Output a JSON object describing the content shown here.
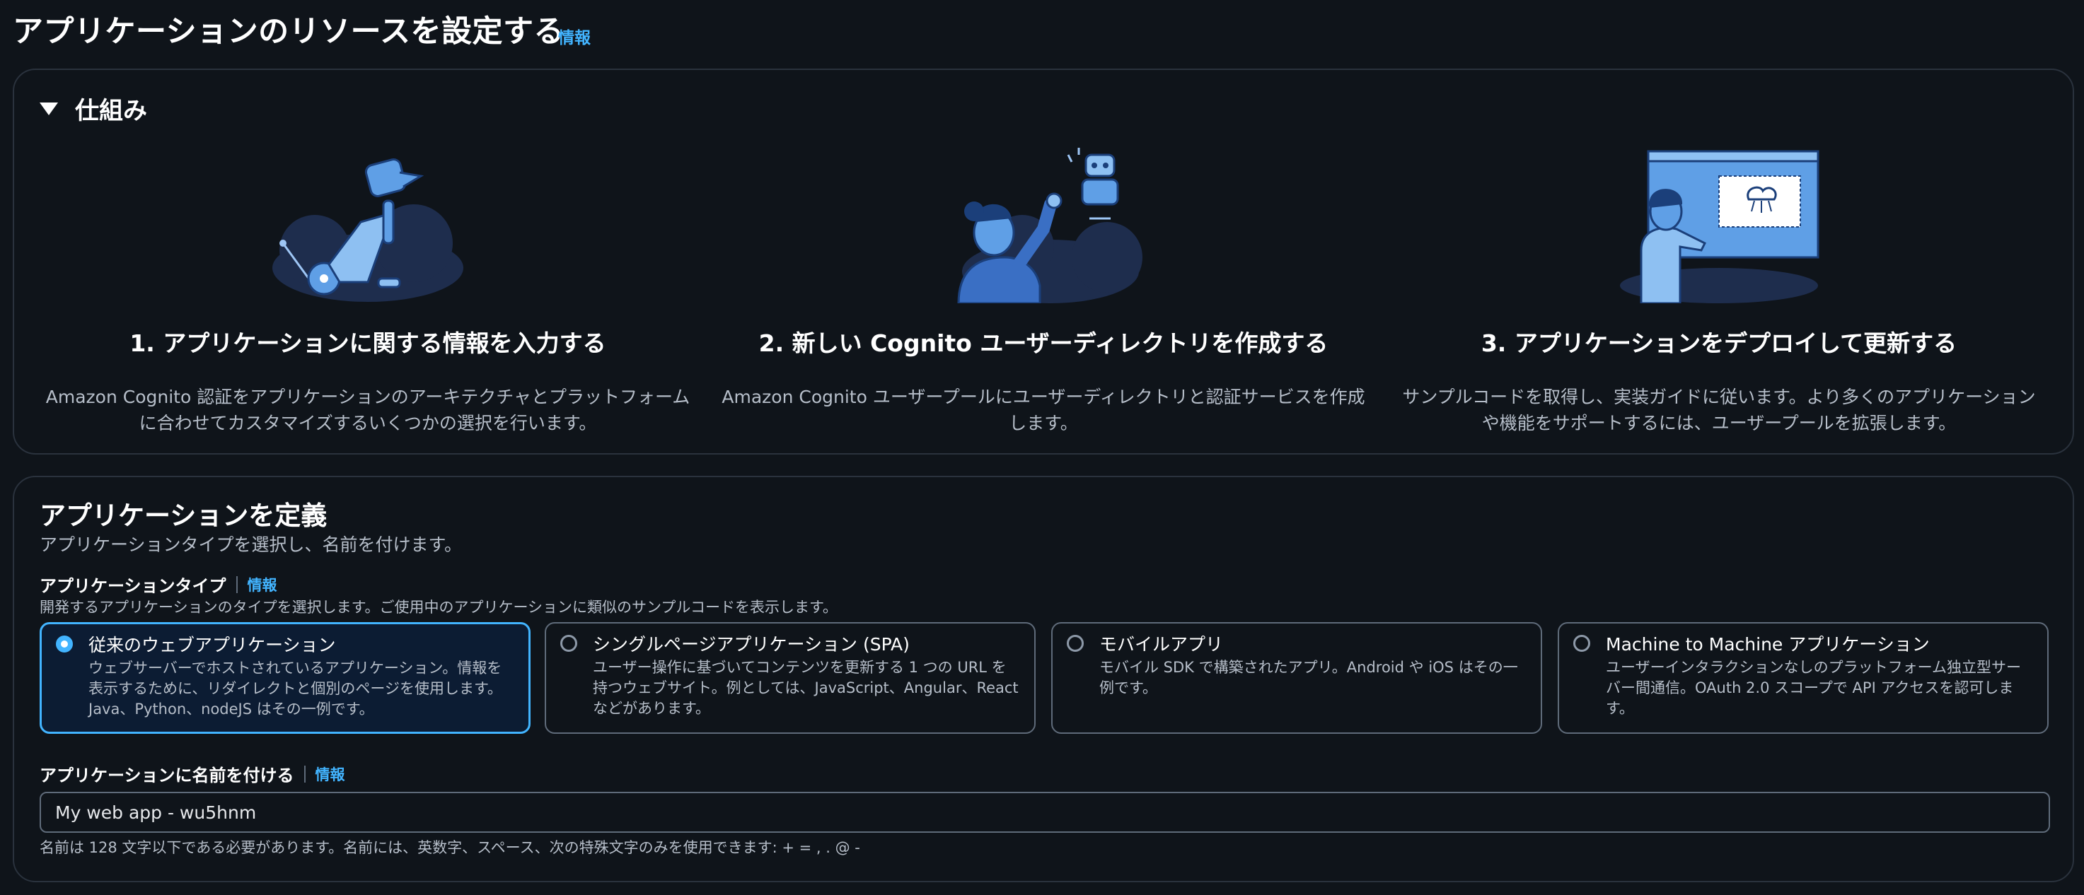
{
  "page": {
    "title": "アプリケーションのリソースを設定する",
    "info": "情報"
  },
  "how_it_works": {
    "title": "仕組み",
    "steps": [
      {
        "title": "1. アプリケーションに関する情報を入力する",
        "description": "Amazon Cognito 認証をアプリケーションのアーキテクチャとプラットフォームに合わせてカスタマイズするいくつかの選択を行います。"
      },
      {
        "title": "2. 新しい Cognito ユーザーディレクトリを作成する",
        "description": "Amazon Cognito ユーザープールにユーザーディレクトリと認証サービスを作成します。"
      },
      {
        "title": "3. アプリケーションをデプロイして更新する",
        "description": "サンプルコードを取得し、実装ガイドに従います。より多くのアプリケーションや機能をサポートするには、ユーザープールを拡張します。"
      }
    ]
  },
  "define_app": {
    "title": "アプリケーションを定義",
    "description": "アプリケーションタイプを選択し、名前を付けます。",
    "type_label": "アプリケーションタイプ",
    "type_info": "情報",
    "type_help": "開発するアプリケーションのタイプを選択します。ご使用中のアプリケーションに類似のサンプルコードを表示します。",
    "types": [
      {
        "title": "従来のウェブアプリケーション",
        "description": "ウェブサーバーでホストされているアプリケーション。情報を表示するために、リダイレクトと個別のページを使用します。Java、Python、nodeJS はその一例です。",
        "selected": true
      },
      {
        "title": "シングルページアプリケーション (SPA)",
        "description": "ユーザー操作に基づいてコンテンツを更新する 1 つの URL を持つウェブサイト。例としては、JavaScript、Angular、React などがあります。",
        "selected": false
      },
      {
        "title": "モバイルアプリ",
        "description": "モバイル SDK で構築されたアプリ。Android や iOS はその一例です。",
        "selected": false
      },
      {
        "title": "Machine to Machine アプリケーション",
        "description": "ユーザーインタラクションなしのプラットフォーム独立型サーバー間通信。OAuth 2.0 スコープで API アクセスを認可します。",
        "selected": false
      }
    ],
    "name_label": "アプリケーションに名前を付ける",
    "name_info": "情報",
    "name_value": "My web app - wu5hnm",
    "name_help": "名前は 128 文字以下である必要があります。名前には、英数字、スペース、次の特殊文字のみを使用できます: + = , . @ -"
  },
  "colors": {
    "background": "#0f141a",
    "accent": "#42b4ff",
    "border": "#2a323d",
    "illustration": "#5f9fe6"
  }
}
